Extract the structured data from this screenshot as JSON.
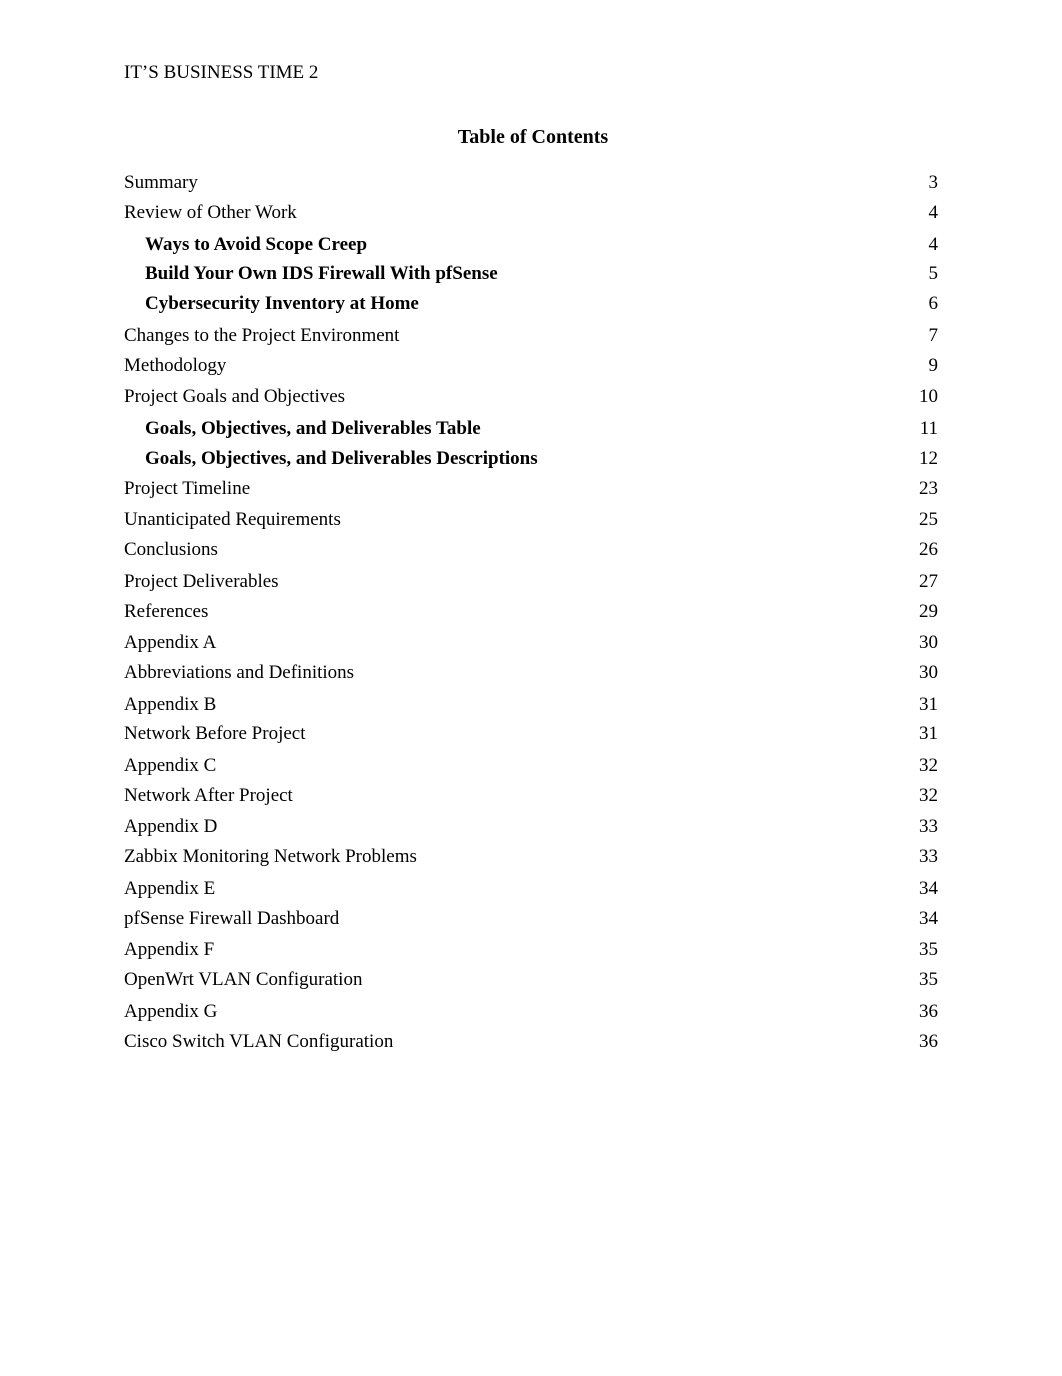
{
  "header": {
    "running_head": "IT’S BUSINESS TIME",
    "page_number": "2"
  },
  "title": "Table of Contents",
  "toc": [
    {
      "label": "Summary",
      "page": "3",
      "level": 1
    },
    {
      "label": "Review of Other Work",
      "page": "4",
      "level": 1
    },
    {
      "label": "Ways to Avoid Scope Creep",
      "page": "4",
      "level": 2
    },
    {
      "label": "Build Your Own IDS Firewall With pfSense",
      "page": "5",
      "level": 2
    },
    {
      "label": "Cybersecurity Inventory at Home",
      "page": "6",
      "level": 2
    },
    {
      "label": "Changes to the Project Environment",
      "page": "7",
      "level": 1
    },
    {
      "label": "Methodology",
      "page": "9",
      "level": 1
    },
    {
      "label": "Project Goals and Objectives",
      "page": "10",
      "level": 1
    },
    {
      "label": "Goals, Objectives, and Deliverables Table",
      "page": "11",
      "level": 2
    },
    {
      "label": "Goals, Objectives, and Deliverables Descriptions",
      "page": "12",
      "level": 2
    },
    {
      "label": "Project Timeline",
      "page": "23",
      "level": 1
    },
    {
      "label": "Unanticipated Requirements",
      "page": "25",
      "level": 1
    },
    {
      "label": "Conclusions",
      "page": "26",
      "level": 1
    },
    {
      "label": "Project Deliverables",
      "page": "27",
      "level": 1
    },
    {
      "label": "References",
      "page": "29",
      "level": 1
    },
    {
      "label": "Appendix A",
      "page": "30",
      "level": 1
    },
    {
      "label": "Abbreviations and Definitions",
      "page": "30",
      "level": 1
    },
    {
      "label": "Appendix B",
      "page": "31",
      "level": 1
    },
    {
      "label": "Network Before Project",
      "page": "31",
      "level": 1
    },
    {
      "label": "Appendix C",
      "page": "32",
      "level": 1
    },
    {
      "label": "Network After Project",
      "page": "32",
      "level": 1
    },
    {
      "label": "Appendix D",
      "page": "33",
      "level": 1
    },
    {
      "label": "Zabbix Monitoring Network Problems",
      "page": "33",
      "level": 1
    },
    {
      "label": "Appendix E",
      "page": "34",
      "level": 1
    },
    {
      "label": "pfSense Firewall Dashboard",
      "page": "34",
      "level": 1
    },
    {
      "label": "Appendix F",
      "page": "35",
      "level": 1
    },
    {
      "label": "OpenWrt VLAN Configuration",
      "page": "35",
      "level": 1
    },
    {
      "label": "Appendix G",
      "page": "36",
      "level": 1
    },
    {
      "label": "Cisco Switch VLAN Configuration",
      "page": "36",
      "level": 1
    }
  ]
}
